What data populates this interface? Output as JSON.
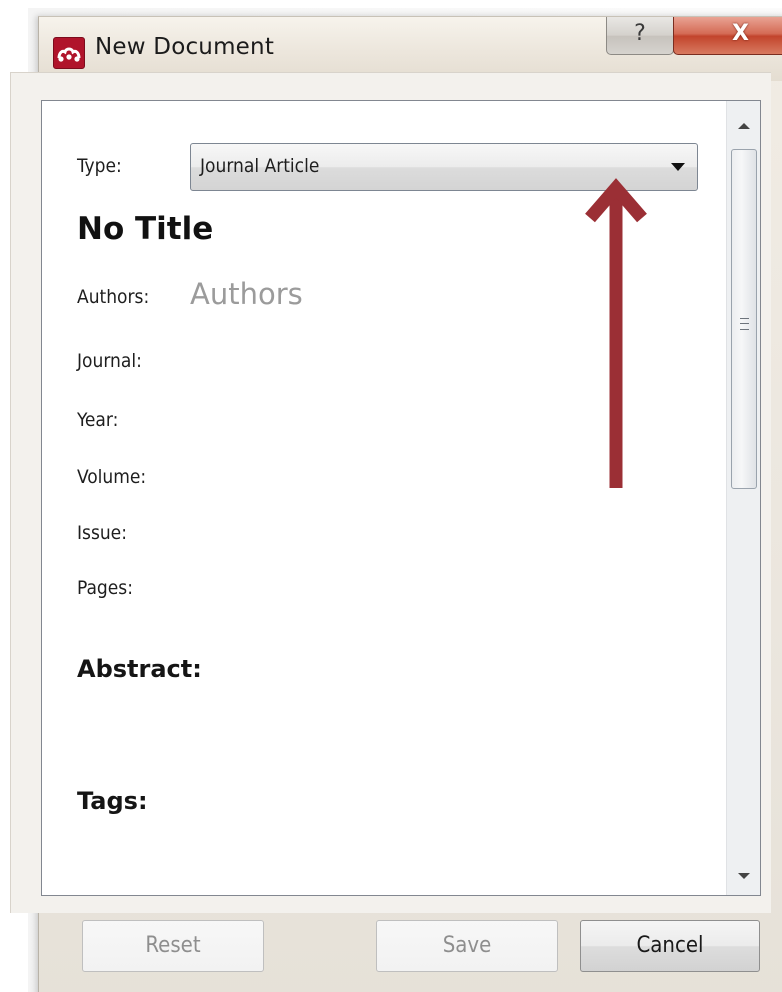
{
  "window": {
    "title": "New Document",
    "help_label": "?",
    "close_label": "X"
  },
  "form": {
    "type_label": "Type:",
    "type_value": "Journal Article",
    "doc_title": "No Title",
    "authors_label": "Authors:",
    "authors_placeholder": "Authors",
    "journal_label": "Journal:",
    "year_label": "Year:",
    "volume_label": "Volume:",
    "issue_label": "Issue:",
    "pages_label": "Pages:",
    "abstract_heading": "Abstract:",
    "tags_heading": "Tags:"
  },
  "buttons": {
    "reset": "Reset",
    "save": "Save",
    "cancel": "Cancel"
  },
  "colors": {
    "annotation_arrow": "#9b2f35",
    "close_button": "#c8462d",
    "app_icon": "#b0142b"
  },
  "icons": {
    "app": "mendeley-logo-icon",
    "scroll_up": "chevron-up-icon",
    "scroll_down": "chevron-down-icon",
    "dropdown": "caret-down-icon"
  }
}
